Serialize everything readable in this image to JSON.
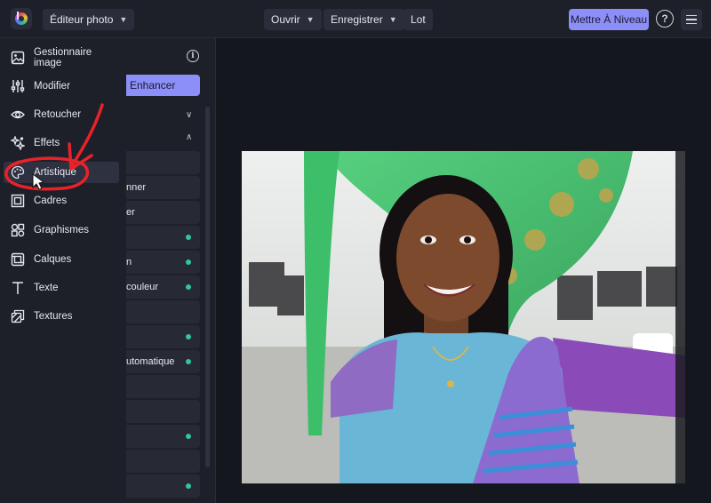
{
  "topbar": {
    "mode_label": "Éditeur photo",
    "open_label": "Ouvrir",
    "save_label": "Enregistrer",
    "batch_label": "Lot",
    "upgrade_label": "Mettre À Niveau",
    "help_label": "?"
  },
  "menu": {
    "items": [
      {
        "label": "Gestionnaire image",
        "icon": "image-icon"
      },
      {
        "label": "Modifier",
        "icon": "sliders-icon"
      },
      {
        "label": "Retoucher",
        "icon": "eye-icon"
      },
      {
        "label": "Effets",
        "icon": "sparkles-icon"
      },
      {
        "label": "Artistique",
        "icon": "palette-icon"
      },
      {
        "label": "Cadres",
        "icon": "frame-icon"
      },
      {
        "label": "Graphismes",
        "icon": "shapes-icon"
      },
      {
        "label": "Calques",
        "icon": "layers-icon"
      },
      {
        "label": "Texte",
        "icon": "text-icon"
      },
      {
        "label": "Textures",
        "icon": "texture-icon"
      }
    ],
    "active_index": 4
  },
  "panel": {
    "info_label": "i",
    "enhancer_label": "Enhancer",
    "rows": [
      {
        "label": "",
        "dot": false
      },
      {
        "label": "nner",
        "dot": false
      },
      {
        "label": "er",
        "dot": false
      },
      {
        "label": "",
        "dot": true
      },
      {
        "label": "n",
        "dot": true
      },
      {
        "label": "couleur",
        "dot": true
      },
      {
        "label": "",
        "dot": false
      },
      {
        "label": "",
        "dot": true
      },
      {
        "label": "utomatique",
        "dot": true
      },
      {
        "label": "",
        "dot": false
      },
      {
        "label": "",
        "dot": false
      },
      {
        "label": "",
        "dot": true
      },
      {
        "label": "",
        "dot": false
      },
      {
        "label": "",
        "dot": true
      }
    ]
  },
  "colors": {
    "accent": "#8c8ff7",
    "dot": "#2fc79b",
    "annotation": "#e8222a"
  }
}
